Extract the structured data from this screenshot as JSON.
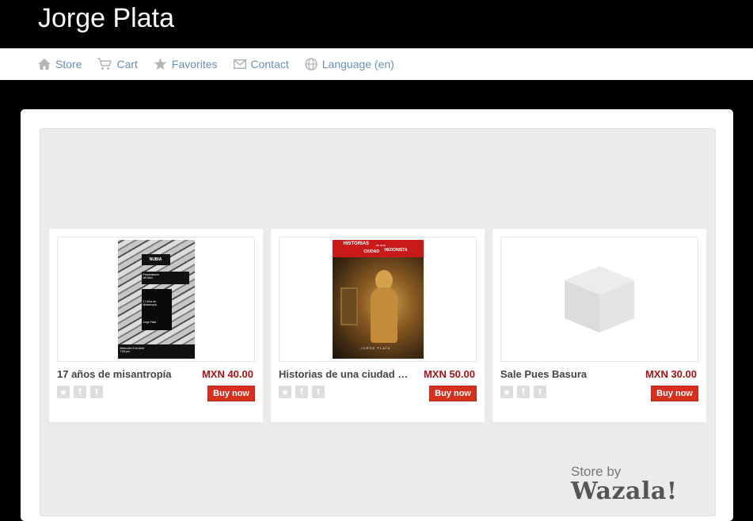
{
  "site": {
    "title": "Jorge Plata"
  },
  "nav": {
    "items": [
      {
        "label": "Store",
        "icon": "home-icon"
      },
      {
        "label": "Cart",
        "icon": "cart-icon"
      },
      {
        "label": "Favorites",
        "icon": "star-icon"
      },
      {
        "label": "Contact",
        "icon": "mail-icon"
      },
      {
        "label": "Language (en)",
        "icon": "globe-icon"
      }
    ]
  },
  "products": [
    {
      "title": "17 años de misantropía",
      "price": "MXN 40.00",
      "buy_label": "Buy now",
      "poster": {
        "brand": "NUBIA",
        "line1": "Presentación",
        "line2": "del libro",
        "line3": "17 Años de Misantropía",
        "line4": "Jorge Plata",
        "date": "Miércoles 5 de Abril",
        "time": "7:00 pm"
      }
    },
    {
      "title": "Historias de una ciudad h ...",
      "price": "MXN 50.00",
      "buy_label": "Buy now",
      "cover": {
        "line1": "HISTORIAS",
        "line2": "de una",
        "line3": "CIUDAD",
        "line4": "HEDONISTA",
        "author": "JORGE PLATA"
      }
    },
    {
      "title": "Sale Pues Basura",
      "price": "MXN 30.00",
      "buy_label": "Buy now"
    }
  ],
  "footer": {
    "store_by": "Store by",
    "brand": "Wazala!"
  },
  "colors": {
    "link": "#6b8fb8",
    "price": "#a8151b",
    "button": "#d6301e"
  }
}
